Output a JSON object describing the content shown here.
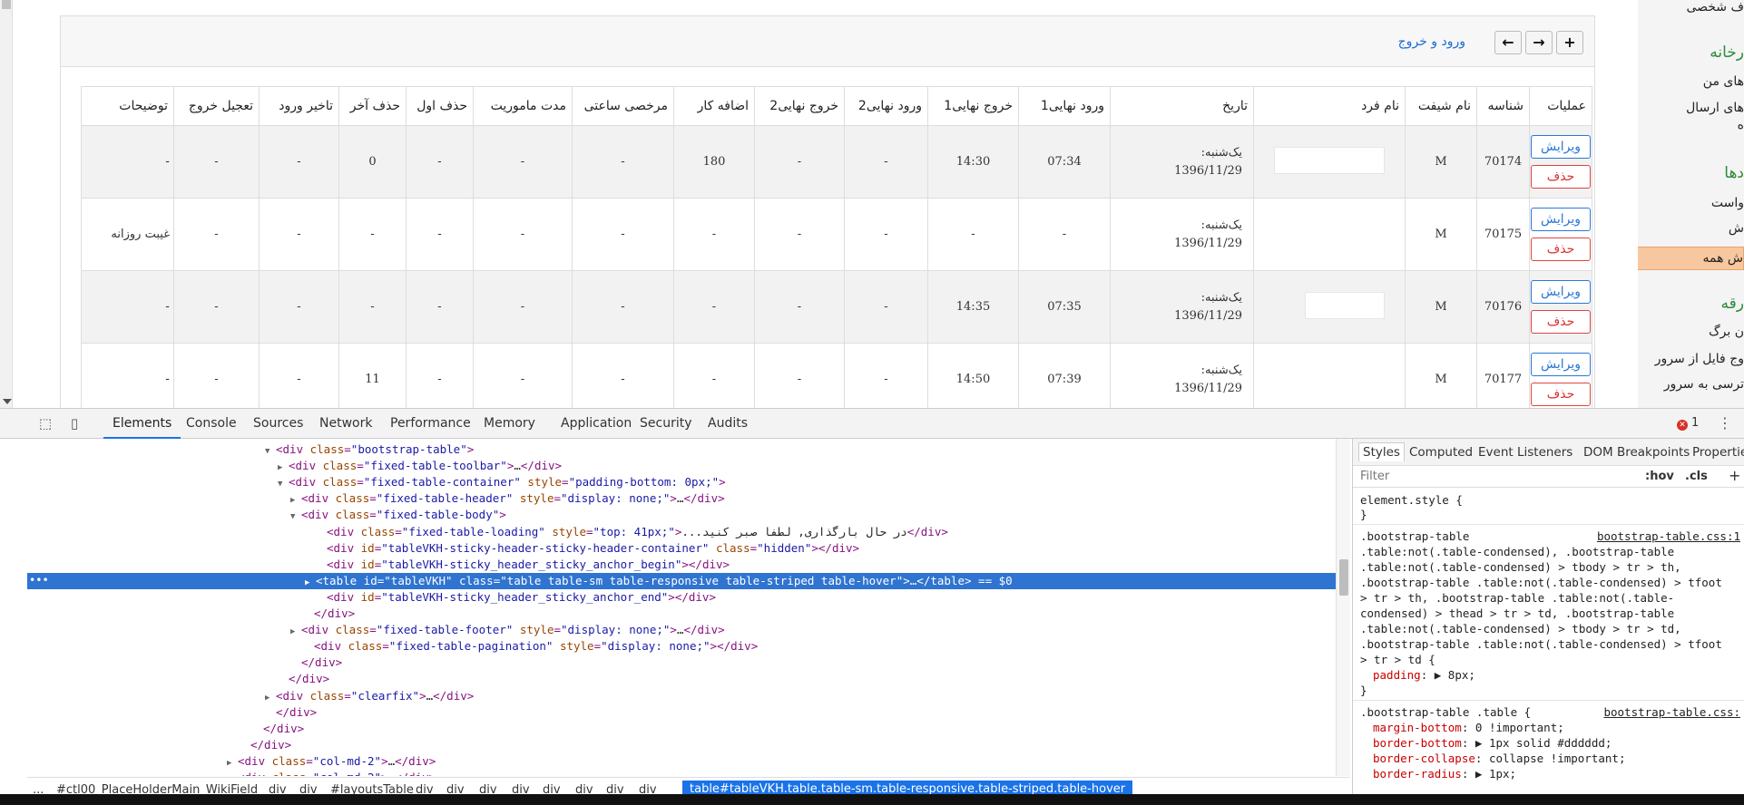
{
  "toolbar": {
    "login_link": "ورود و خروج"
  },
  "table": {
    "headers": [
      "توضیحات",
      "تعجیل خروج",
      "تاخیر ورود",
      "حذف آخر",
      "حذف اول",
      "مدت ماموریت",
      "مرخصی ساعتی",
      "اضافه کار",
      "خروج نهایی2",
      "ورود نهایی2",
      "خروج نهایی1",
      "ورود نهایی1",
      "تاریخ",
      "نام فرد",
      "نام شیفت",
      "شناسه",
      "عملیات"
    ],
    "edit_label": "ویرایش",
    "delete_label": "حذف",
    "rows": [
      {
        "desc": "-",
        "early": "-",
        "late": "-",
        "dellast": "0",
        "delfirst": "-",
        "mission": "-",
        "hourly": "-",
        "overtime": "180",
        "out2": "-",
        "in2": "-",
        "out1": "14:30",
        "in1": "07:34",
        "date_day": "یک‌شنبه:",
        "date": "1396/11/29",
        "shift": "M",
        "id": "70174"
      },
      {
        "desc": "غیبت روزانه",
        "early": "-",
        "late": "-",
        "dellast": "-",
        "delfirst": "-",
        "mission": "-",
        "hourly": "-",
        "overtime": "-",
        "out2": "-",
        "in2": "-",
        "out1": "-",
        "in1": "-",
        "date_day": "یک‌شنبه:",
        "date": "1396/11/29",
        "shift": "M",
        "id": "70175"
      },
      {
        "desc": "-",
        "early": "-",
        "late": "-",
        "dellast": "-",
        "delfirst": "-",
        "mission": "-",
        "hourly": "-",
        "overtime": "-",
        "out2": "-",
        "in2": "-",
        "out1": "14:35",
        "in1": "07:35",
        "date_day": "یک‌شنبه:",
        "date": "1396/11/29",
        "shift": "M",
        "id": "70176"
      },
      {
        "desc": "-",
        "early": "-",
        "late": "-",
        "dellast": "11",
        "delfirst": "-",
        "mission": "-",
        "hourly": "-",
        "overtime": "-",
        "out2": "-",
        "in2": "-",
        "out1": "14:50",
        "in1": "07:39",
        "date_day": "یک‌شنبه:",
        "date": "1396/11/29",
        "shift": "M",
        "id": "70177"
      }
    ]
  },
  "right_sidebar": {
    "items": [
      {
        "label": "ف شخصی",
        "kind": "item"
      },
      {
        "label": "رخانه",
        "kind": "head"
      },
      {
        "label": "های من",
        "kind": "item"
      },
      {
        "label": "های ارسال",
        "kind": "item"
      },
      {
        "label": "ه",
        "kind": "item"
      },
      {
        "label": "دها",
        "kind": "head"
      },
      {
        "label": "واست",
        "kind": "item"
      },
      {
        "label": "ش",
        "kind": "item"
      },
      {
        "label": "ش همه",
        "kind": "highlight"
      },
      {
        "label": "رقه",
        "kind": "head"
      },
      {
        "label": "ن برگ",
        "kind": "item"
      },
      {
        "label": "وج فایل از سرور",
        "kind": "item"
      },
      {
        "label": "ترسی به سرور",
        "kind": "item"
      }
    ]
  },
  "devtools": {
    "tabs": [
      "Elements",
      "Console",
      "Sources",
      "Network",
      "Performance",
      "Memory",
      "Application",
      "Security",
      "Audits"
    ],
    "error_count": "1",
    "dom_lines": [
      {
        "tri": "▼",
        "html": "<div class=\"bootstrap-table\">"
      },
      {
        "tri": "▶",
        "html": "<div class=\"fixed-table-toolbar\">…</div>"
      },
      {
        "tri": "▼",
        "html": "<div class=\"fixed-table-container\" style=\"padding-bottom: 0px;\">"
      },
      {
        "tri": "▶",
        "html": "<div class=\"fixed-table-header\" style=\"display: none;\">…</div>"
      },
      {
        "tri": "▼",
        "html": "<div class=\"fixed-table-body\">"
      },
      {
        "tri": "",
        "html": "<div class=\"fixed-table-loading\" style=\"top: 41px;\">...در حال بارگذاری, لطفا صبر کنید</div>"
      },
      {
        "tri": "",
        "html": "<div id=\"tableVKH-sticky-header-sticky-header-container\" class=\"hidden\"></div>"
      },
      {
        "tri": "",
        "html": "<div id=\"tableVKH-sticky_header_sticky_anchor_begin\"></div>"
      },
      {
        "tri": "▶",
        "html": "<table id=\"tableVKH\" class=\"table table-sm table-responsive table-striped table-hover\">…</table> == $0"
      },
      {
        "tri": "",
        "html": "<div id=\"tableVKH-sticky_header_sticky_anchor_end\"></div>"
      },
      {
        "tri": "",
        "html": "</div>"
      },
      {
        "tri": "▶",
        "html": "<div class=\"fixed-table-footer\" style=\"display: none;\">…</div>"
      },
      {
        "tri": "",
        "html": "<div class=\"fixed-table-pagination\" style=\"display: none;\"></div>"
      },
      {
        "tri": "",
        "html": "</div>"
      },
      {
        "tri": "",
        "html": "</div>"
      },
      {
        "tri": "▶",
        "html": "<div class=\"clearfix\">…</div>"
      },
      {
        "tri": "",
        "html": "</div>"
      },
      {
        "tri": "",
        "html": "</div>"
      },
      {
        "tri": "",
        "html": "</div>"
      },
      {
        "tri": "▶",
        "html": "<div class=\"col-md-2\">…</div>"
      },
      {
        "tri": "▶",
        "html": "<div class=\"col-md-2\">…</div>"
      }
    ],
    "breadcrumbs": [
      "...",
      "#ctl00_PlaceHolderMain_WikiField",
      "div",
      "div",
      "#layoutsTable",
      "div",
      "div",
      "div",
      "div",
      "div",
      "div",
      "div",
      "div"
    ],
    "breadcrumb_selected": "table#tableVKH.table.table-sm.table-responsive.table-striped.table-hover",
    "styles_tabs": [
      "Styles",
      "Computed",
      "Event Listeners",
      "DOM Breakpoints",
      "Properties"
    ],
    "filter_placeholder": "Filter",
    "hov": ":hov",
    "cls": ".cls",
    "plus": "+",
    "element_style": "element.style {",
    "close_brace": "}",
    "rule1_source": "bootstrap-table.css:1",
    "rule1_lines": [
      ".bootstrap-table",
      ".table:not(.table-condensed), .bootstrap-table",
      ".table:not(.table-condensed) > tbody > tr > th,",
      ".bootstrap-table .table:not(.table-condensed) > tfoot",
      "> tr > th, .bootstrap-table .table:not(.table-",
      "condensed) > thead > tr > td, .bootstrap-table",
      ".table:not(.table-condensed) > tbody > tr > td,",
      ".bootstrap-table .table:not(.table-condensed) > tfoot",
      "> tr > td {"
    ],
    "rule1_prop": "padding",
    "rule1_val": "8px;",
    "rule2_selector": ".bootstrap-table .table {",
    "rule2_source": "bootstrap-table.css:",
    "rule2_props": [
      {
        "prop": "margin-bottom",
        "val": "0 !important;"
      },
      {
        "prop": "border-bottom",
        "val": "1px solid #dddddd;"
      },
      {
        "prop": "border-collapse",
        "val": "collapse !important;"
      },
      {
        "prop": "border-radius",
        "val": "1px;"
      }
    ]
  }
}
